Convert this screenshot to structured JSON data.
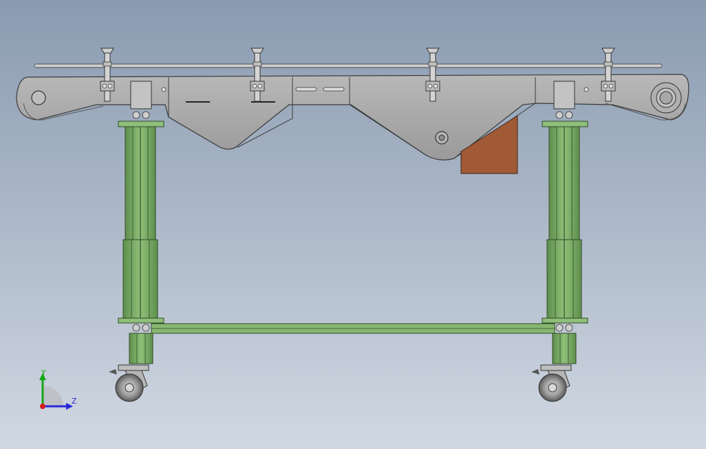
{
  "viewport": {
    "background_top": "#8a9bb1",
    "background_bottom": "#d0d8e2"
  },
  "colors": {
    "frame_gray": "#a6a6a6",
    "frame_edge": "#3a3a3a",
    "leg_green": "#7fb26a",
    "leg_dark": "#4d7a3f",
    "motor_orange": "#a05a36",
    "rail_silver": "#c9c9c9"
  },
  "triad": {
    "y_label": "Y",
    "z_label": "Z",
    "y_color": "#14a614",
    "z_color": "#2929d6",
    "x_color": "#d61f1f"
  },
  "guide_rail_clamps": 4,
  "support_legs": 2,
  "casters": 2
}
